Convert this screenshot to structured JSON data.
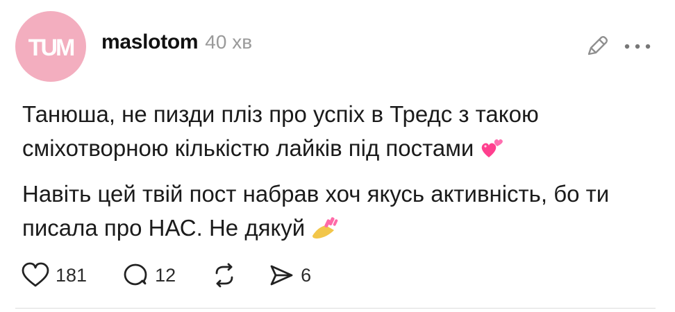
{
  "post": {
    "avatar_text": "TUM",
    "username": "maslotom",
    "time": "40 хв",
    "paragraphs": [
      "Танюша, не пизди пліз про успіх в Тредс з такою сміхотворною кількістю лайків під постами",
      "Навіть цей твій пост набрав хоч якусь активність, бо ти писала про НАС. Не дякуй"
    ],
    "emojis": [
      "sparkling-hearts",
      "nail-polish"
    ],
    "likes": "181",
    "replies": "12",
    "shares": "6"
  },
  "colors": {
    "avatar_bg": "#f3aebf",
    "text": "#1b1b1b",
    "muted": "#9a9a9a"
  },
  "icons": [
    "heart-icon",
    "comment-icon",
    "repost-icon",
    "share-icon",
    "edit-icon",
    "more-icon"
  ]
}
